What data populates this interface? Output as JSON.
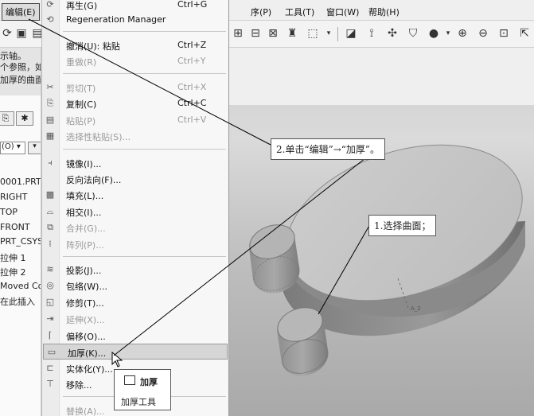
{
  "menubar": {
    "edit": "编辑(E)",
    "items": [
      "序(P)",
      "工具(T)",
      "窗口(W)",
      "帮助(H)"
    ]
  },
  "left_panel": {
    "messages": [
      "示轴。",
      "个参照，如",
      "加厚的曲面"
    ],
    "combo_value": "(O) ▾",
    "combo2_value": "▾",
    "tree_items": [
      "0001.PRT",
      "RIGHT",
      "TOP",
      "FRONT",
      "PRT_CSYS_",
      "拉伸 1",
      "拉伸 2",
      "Moved Co",
      "在此插入"
    ]
  },
  "edit_menu": {
    "items": [
      {
        "label": "再生(G)",
        "shortcut": "Ctrl+G",
        "disabled": false
      },
      {
        "label": "Regeneration Manager",
        "shortcut": "",
        "disabled": false
      },
      {
        "label": "撤消(U): 粘贴",
        "shortcut": "Ctrl+Z",
        "disabled": false
      },
      {
        "label": "重做(R)",
        "shortcut": "Ctrl+Y",
        "disabled": true
      },
      {
        "label": "剪切(T)",
        "shortcut": "Ctrl+X",
        "disabled": true
      },
      {
        "label": "复制(C)",
        "shortcut": "Ctrl+C",
        "disabled": false
      },
      {
        "label": "粘贴(P)",
        "shortcut": "Ctrl+V",
        "disabled": true
      },
      {
        "label": "选择性粘贴(S)...",
        "shortcut": "",
        "disabled": true
      },
      {
        "label": "镜像(I)...",
        "shortcut": "",
        "disabled": false
      },
      {
        "label": "反向法向(F)...",
        "shortcut": "",
        "disabled": false
      },
      {
        "label": "填充(L)...",
        "shortcut": "",
        "disabled": false
      },
      {
        "label": "相交(I)...",
        "shortcut": "",
        "disabled": false
      },
      {
        "label": "合并(G)...",
        "shortcut": "",
        "disabled": true
      },
      {
        "label": "阵列(P)...",
        "shortcut": "",
        "disabled": true
      },
      {
        "label": "投影(J)...",
        "shortcut": "",
        "disabled": false
      },
      {
        "label": "包络(W)...",
        "shortcut": "",
        "disabled": false
      },
      {
        "label": "修剪(T)...",
        "shortcut": "",
        "disabled": false
      },
      {
        "label": "延伸(X)...",
        "shortcut": "",
        "disabled": true
      },
      {
        "label": "偏移(O)...",
        "shortcut": "",
        "disabled": false
      },
      {
        "label": "加厚(K)...",
        "shortcut": "",
        "disabled": false
      },
      {
        "label": "实体化(Y)...",
        "shortcut": "",
        "disabled": false
      },
      {
        "label": "移除...",
        "shortcut": "",
        "disabled": false
      },
      {
        "label": "替换(A)...",
        "shortcut": "",
        "disabled": true
      }
    ]
  },
  "tooltip": {
    "title": "加厚",
    "description": "加厚工具"
  },
  "callouts": {
    "step2": "2.单击“编辑”→“加厚”。",
    "step1": "1.选择曲面；"
  },
  "viewport": {
    "axis_label": "A_2"
  }
}
